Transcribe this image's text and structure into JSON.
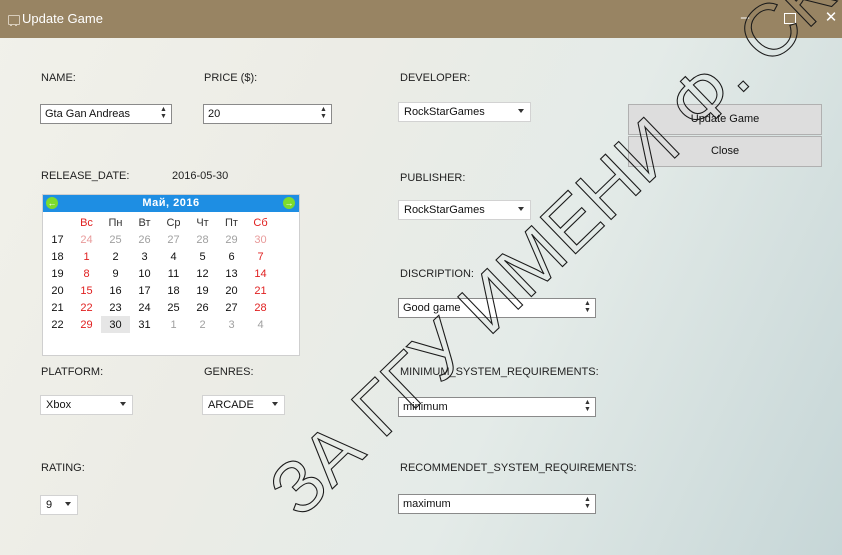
{
  "window": {
    "title": "Update Game",
    "min_glyph": "–",
    "close_glyph": "✕"
  },
  "name": {
    "label": "NAME:",
    "value": "Gta Gan Andreas"
  },
  "price": {
    "label": "PRICE ($):",
    "value": "20"
  },
  "developer": {
    "label": "DEVELOPER:",
    "value": "RockStarGames"
  },
  "publisher": {
    "label": "PUBLISHER:",
    "value": "RockStarGames"
  },
  "release": {
    "label": "RELEASE_DATE:",
    "value": "2016-05-30"
  },
  "calendar": {
    "prev": "←",
    "next": "→",
    "title": "Май, 2016",
    "day_names": [
      "Вс",
      "Пн",
      "Вт",
      "Ср",
      "Чт",
      "Пт",
      "Сб"
    ],
    "weeks": [
      {
        "num": "17",
        "days": [
          "24",
          "25",
          "26",
          "27",
          "28",
          "29",
          "30"
        ]
      },
      {
        "num": "18",
        "days": [
          "1",
          "2",
          "3",
          "4",
          "5",
          "6",
          "7"
        ]
      },
      {
        "num": "19",
        "days": [
          "8",
          "9",
          "10",
          "11",
          "12",
          "13",
          "14"
        ]
      },
      {
        "num": "20",
        "days": [
          "15",
          "16",
          "17",
          "18",
          "19",
          "20",
          "21"
        ]
      },
      {
        "num": "21",
        "days": [
          "22",
          "23",
          "24",
          "25",
          "26",
          "27",
          "28"
        ]
      },
      {
        "num": "22",
        "days": [
          "29",
          "30",
          "31",
          "1",
          "2",
          "3",
          "4"
        ]
      }
    ]
  },
  "description": {
    "label": "DISCRIPTION:",
    "value": "Good game"
  },
  "platform": {
    "label": "PLATFORM:",
    "value": "Xbox"
  },
  "genres": {
    "label": "GENRES:",
    "value": "ARCADE"
  },
  "min_req": {
    "label": "MINIMUM_SYSTEM_REQUIREMENTS:",
    "value": "minimum"
  },
  "rec_req": {
    "label": "RECOMMENDET_SYSTEM_REQUIREMENTS:",
    "value": "maximum"
  },
  "rating": {
    "label": "RATING:",
    "value": "9"
  },
  "buttons": {
    "update": "Update Game",
    "close": "Close"
  },
  "watermark": {
    "text": "ЗА ГГУ ИМЕНИ Ф. СКОРИНЫ"
  },
  "colors": {
    "titlebar": "#988463",
    "calendar_header": "#1e8ee3",
    "calendar_nav": "#7ddb2d",
    "weekend": "#e02020"
  }
}
